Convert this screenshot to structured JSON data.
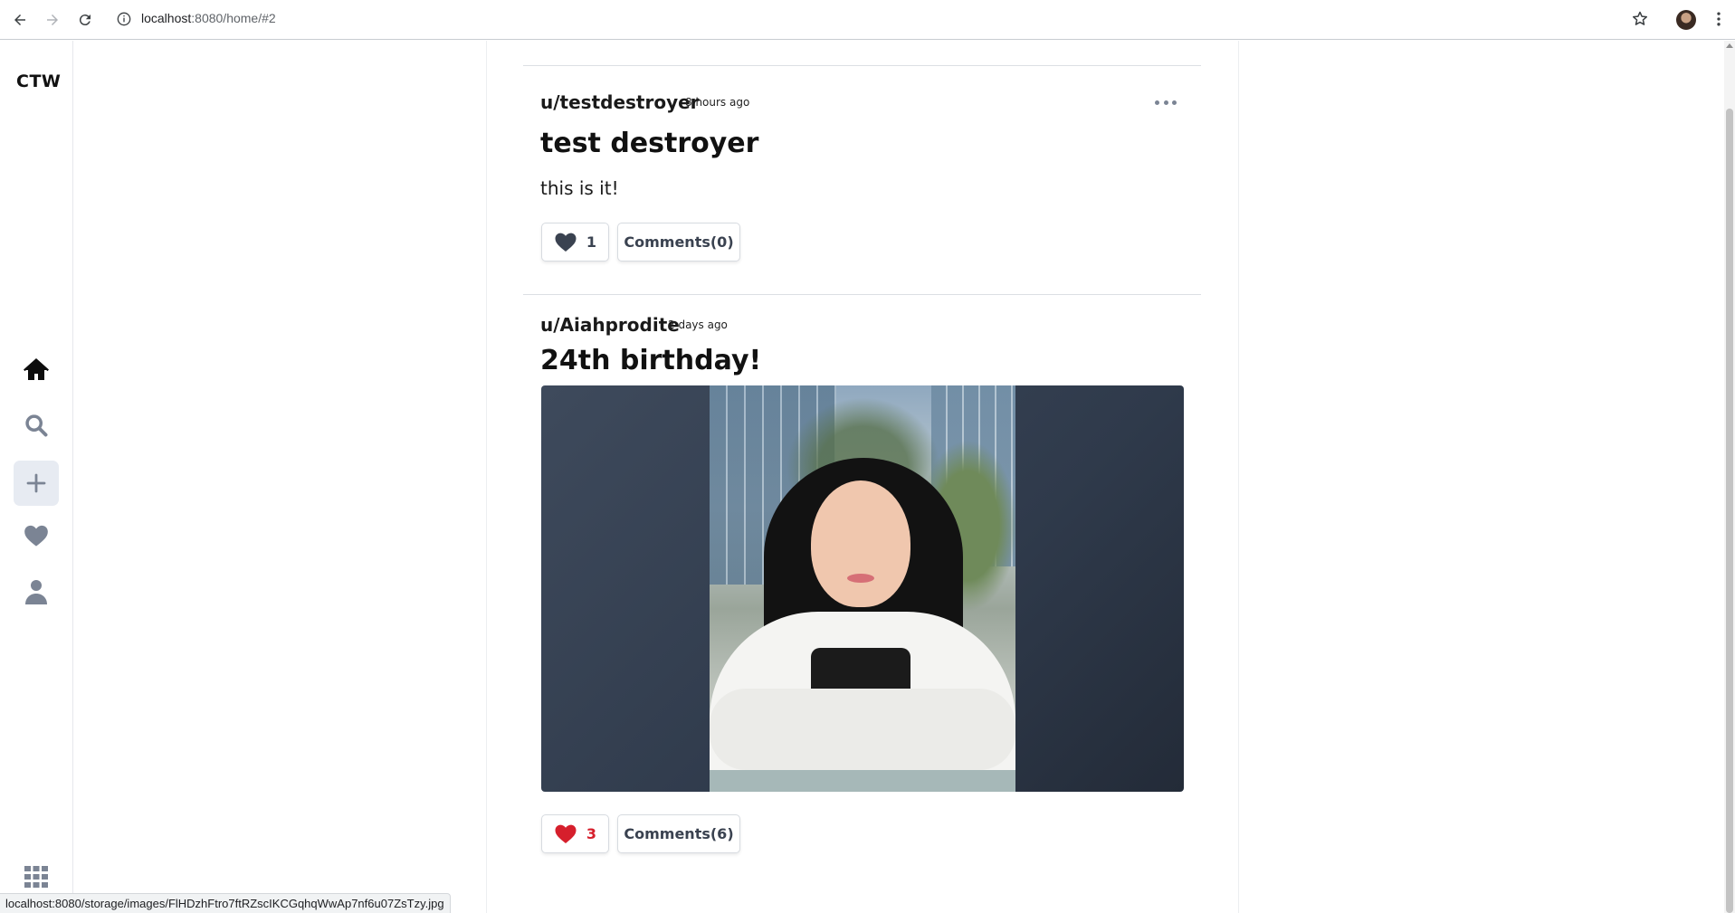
{
  "browser": {
    "url_host": "localhost",
    "url_rest": ":8080/home/#2",
    "status_url": "localhost:8080/storage/images/FlHDzhFtro7ftRZscIKCGqhqWwAp7nf6u07ZsTzy.jpg"
  },
  "sidebar": {
    "logo": "CTW",
    "items": [
      {
        "icon": "home-icon"
      },
      {
        "icon": "search-icon"
      },
      {
        "icon": "plus-icon"
      },
      {
        "icon": "heart-icon"
      },
      {
        "icon": "user-icon"
      },
      {
        "icon": "grid-icon"
      }
    ]
  },
  "posts": [
    {
      "user": "u/testdestroyer",
      "time": "8 hours ago",
      "title": "test destroyer",
      "body": "this is it!",
      "likes": "1",
      "liked": false,
      "comments": "Comments(0)"
    },
    {
      "user": "u/Aiahprodite",
      "time": "2 days ago",
      "title": "24th birthday!",
      "likes": "3",
      "liked": true,
      "comments": "Comments(6)"
    }
  ],
  "colors": {
    "accent_red": "#d61f2c",
    "icon_gray": "#7b8494",
    "active_bg": "#e7ebf2"
  }
}
